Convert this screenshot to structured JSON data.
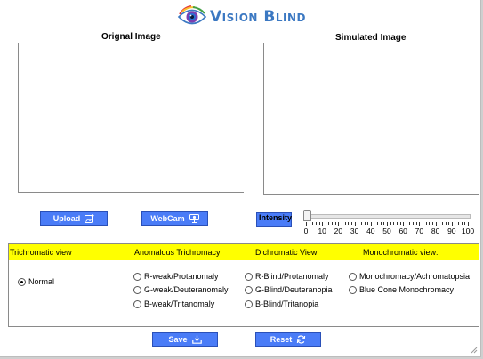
{
  "app": {
    "logo_text": "Vision Blind",
    "original_title": "Orignal Image",
    "simulated_title": "Simulated Image"
  },
  "buttons": {
    "upload": "Upload",
    "webcam": "WebCam",
    "save": "Save",
    "reset": "Reset"
  },
  "intensity": {
    "label": "Intensity",
    "value": 0,
    "ticks": [
      "0",
      "10",
      "20",
      "30",
      "40",
      "50",
      "60",
      "70",
      "80",
      "90",
      "100"
    ]
  },
  "groups": {
    "trichromatic": "Trichromatic view",
    "anomalous": "Anomalous Trichromacy",
    "dichromatic": "Dichromatic View",
    "monochromatic": "Monochromatic view:"
  },
  "options": {
    "normal": "Normal",
    "protanomaly": "R-weak/Protanomaly",
    "deuteranomaly": "G-weak/Deuteranomaly",
    "tritanomaly": "B-weak/Tritanomaly",
    "protanopia": "R-Blind/Protanomaly",
    "deuteranopia": "G-Blind/Deuteranopia",
    "tritanopia": "B-Blind/Tritanopia",
    "achromatopsia": "Monochromacy/Achromatopsia",
    "blue_cone": "Blue Cone Monochromacy",
    "selected": "normal"
  },
  "colors": {
    "button_blue": "#4a7cf7",
    "header_yellow": "#ffff00",
    "logo_blue": "#3b78c2"
  }
}
